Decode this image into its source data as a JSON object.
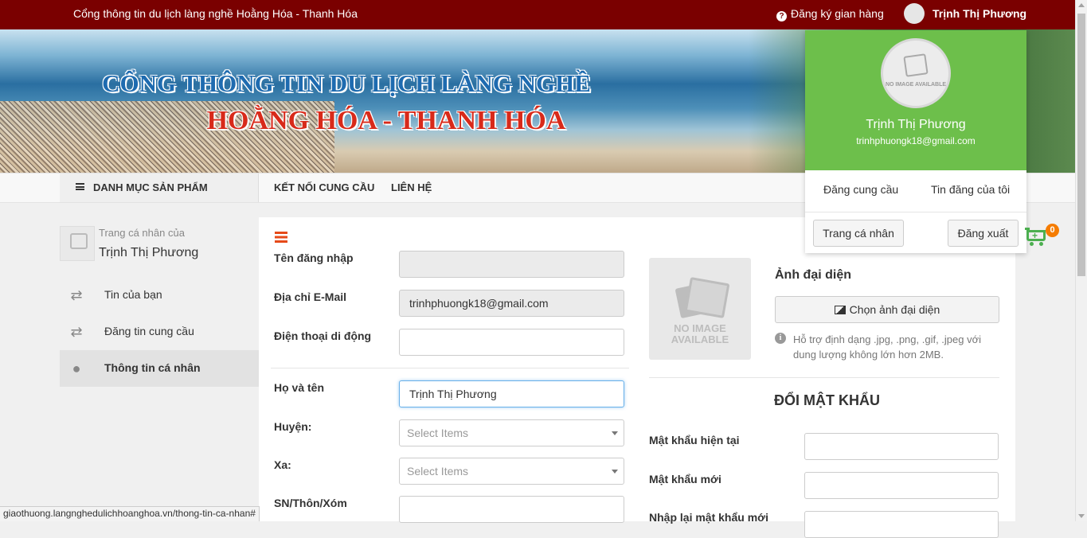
{
  "topbar": {
    "site_title": "Cổng thông tin du lịch làng nghề Hoằng Hóa - Thanh Hóa",
    "register_shop": "Đăng ký gian hàng",
    "user_name": "Trịnh Thị Phương"
  },
  "banner": {
    "line1": "CỔNG THÔNG TIN DU LỊCH LÀNG NGHỀ",
    "line2": "HOẰNG HÓA - THANH HÓA"
  },
  "nav": {
    "category": "DANH MỤC SẢN PHẨM",
    "items": [
      "KẾT NỐI CUNG CẦU",
      "LIÊN HỆ"
    ]
  },
  "sidebar": {
    "owner_label": "Trang cá nhân của",
    "owner_name": "Trịnh Thị Phương",
    "items": [
      {
        "label": "Tin của bạn",
        "icon": "shuffle-icon"
      },
      {
        "label": "Đăng tin cung cầu",
        "icon": "shuffle-icon"
      },
      {
        "label": "Thông tin cá nhân",
        "icon": "user-icon",
        "active": true
      }
    ]
  },
  "form": {
    "username_label": "Tên đăng nhập",
    "username_value": "",
    "email_label": "Địa chỉ E-Mail",
    "email_value": "trinhphuongk18@gmail.com",
    "phone_label": "Điện thoại di động",
    "phone_value": "",
    "fullname_label": "Họ và tên",
    "fullname_value": "Trịnh Thị Phương",
    "district_label": "Huyện:",
    "district_placeholder": "Select Items",
    "commune_label": "Xa:",
    "commune_placeholder": "Select Items",
    "address_label": "SN/Thôn/Xóm",
    "address_value": ""
  },
  "avatar_section": {
    "noimage_text": "NO IMAGE AVAILABLE",
    "title": "Ảnh đại diện",
    "choose_button": "Chọn ảnh đại diện",
    "support_text": "Hỗ trợ định dạng .jpg, .png, .gif, .jpeg với dung lượng không lớn hơn 2MB."
  },
  "password_section": {
    "title": "ĐỔI MẬT KHẨU",
    "current_label": "Mật khẩu hiện tại",
    "new_label": "Mật khẩu mới",
    "confirm_label": "Nhập lại mật khẩu mới"
  },
  "user_dropdown": {
    "avatar_text": "NO IMAGE AVAILABLE",
    "name": "Trịnh Thị Phương",
    "email": "trinhphuongk18@gmail.com",
    "link_post_supply": "Đăng cung cầu",
    "link_my_posts": "Tin đăng của tôi",
    "profile_button": "Trang cá nhân",
    "logout_button": "Đăng xuất",
    "header_color": "#6dbf4b"
  },
  "cart": {
    "count": "0"
  },
  "status_url": "giaothuong.langnghedulichhoanghoa.vn/thong-tin-ca-nhan#",
  "colors": {
    "topbar": "#7a0000",
    "accent": "#e64a19",
    "cart": "#4caf50",
    "badge": "#f57c00"
  }
}
